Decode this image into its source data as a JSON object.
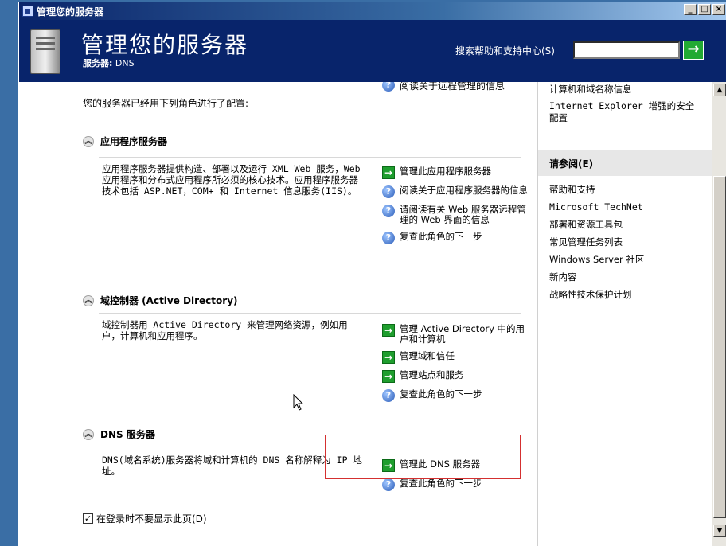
{
  "window": {
    "title": "管理您的服务器",
    "buttons": [
      "_",
      "□",
      "×"
    ]
  },
  "header": {
    "title": "管理您的服务器",
    "server_label": "服务器:",
    "server_name": "DNS",
    "search_label": "搜索帮助和支持中心(S)",
    "search_value": "",
    "search_go": "→"
  },
  "main": {
    "top_link": "阅读关于远程管理的信息",
    "intro": "您的服务器已经用下列角色进行了配置:",
    "sections": [
      {
        "title": "应用程序服务器",
        "description": "应用程序服务器提供构造、部署以及运行 XML Web 服务，Web 应用程序和分布式应用程序所必须的核心技术。应用程序服务器技术包括 ASP.NET，COM+ 和 Internet 信息服务(IIS)。",
        "actions": [
          {
            "type": "arrow",
            "label": "管理此应用程序服务器"
          },
          {
            "type": "help",
            "label": "阅读关于应用程序服务器的信息"
          },
          {
            "type": "help",
            "label": "请阅读有关 Web 服务器远程管理的 Web 界面的信息"
          },
          {
            "type": "help",
            "label": "复查此角色的下一步"
          }
        ]
      },
      {
        "title": "域控制器 (Active Directory)",
        "description": "域控制器用 Active Directory 来管理网络资源，例如用户，计算机和应用程序。",
        "actions": [
          {
            "type": "arrow",
            "label": "管理 Active Directory 中的用户和计算机"
          },
          {
            "type": "arrow",
            "label": "管理域和信任"
          },
          {
            "type": "arrow",
            "label": "管理站点和服务"
          },
          {
            "type": "help",
            "label": "复查此角色的下一步"
          }
        ]
      },
      {
        "title": "DNS 服务器",
        "description": "DNS(域名系统)服务器将域和计算机的 DNS 名称解释为 IP 地址。",
        "actions": [
          {
            "type": "arrow",
            "label": "管理此 DNS 服务器"
          },
          {
            "type": "help",
            "label": "复查此角色的下一步"
          }
        ]
      }
    ],
    "footer_checkbox": "在登录时不要显示此页(D)",
    "footer_checked": "✓"
  },
  "sidebar": {
    "top_items": [
      "计算机和域名称信息",
      "Internet Explorer 增强的安全配置"
    ],
    "see_also_title": "请参阅(E)",
    "see_also": [
      "帮助和支持",
      "Microsoft TechNet",
      "部署和资源工具包",
      "常见管理任务列表",
      "Windows Server 社区",
      "新内容",
      "战略性技术保护计划"
    ]
  },
  "colors": {
    "header_bg": "#08246b",
    "arrow_green": "#1f9e2e",
    "highlight_red": "#d43030"
  }
}
